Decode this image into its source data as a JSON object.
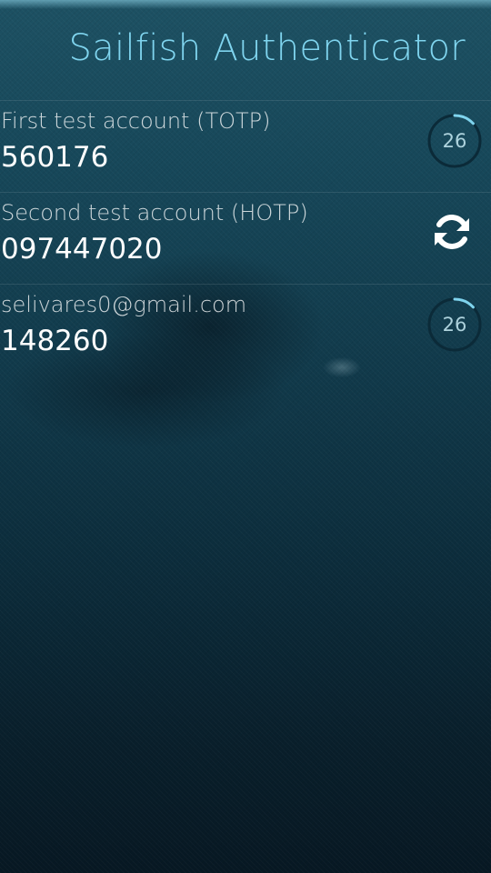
{
  "app": {
    "title": "Sailfish Authenticator"
  },
  "accounts": [
    {
      "name": "First test account (TOTP)",
      "code": "560176",
      "type": "totp",
      "seconds_left": "26",
      "remaining_fraction": 0.13
    },
    {
      "name": "Second test account (HOTP)",
      "code": "097447020",
      "type": "hotp",
      "action_icon": "refresh-icon"
    },
    {
      "name": "selivares0@gmail.com",
      "code": "148260",
      "type": "totp",
      "seconds_left": "26",
      "remaining_fraction": 0.13
    }
  ],
  "colors": {
    "accent": "#7fd4ee",
    "timer_track": "#0b2a38",
    "timer_progress": "#7fd4ee"
  }
}
